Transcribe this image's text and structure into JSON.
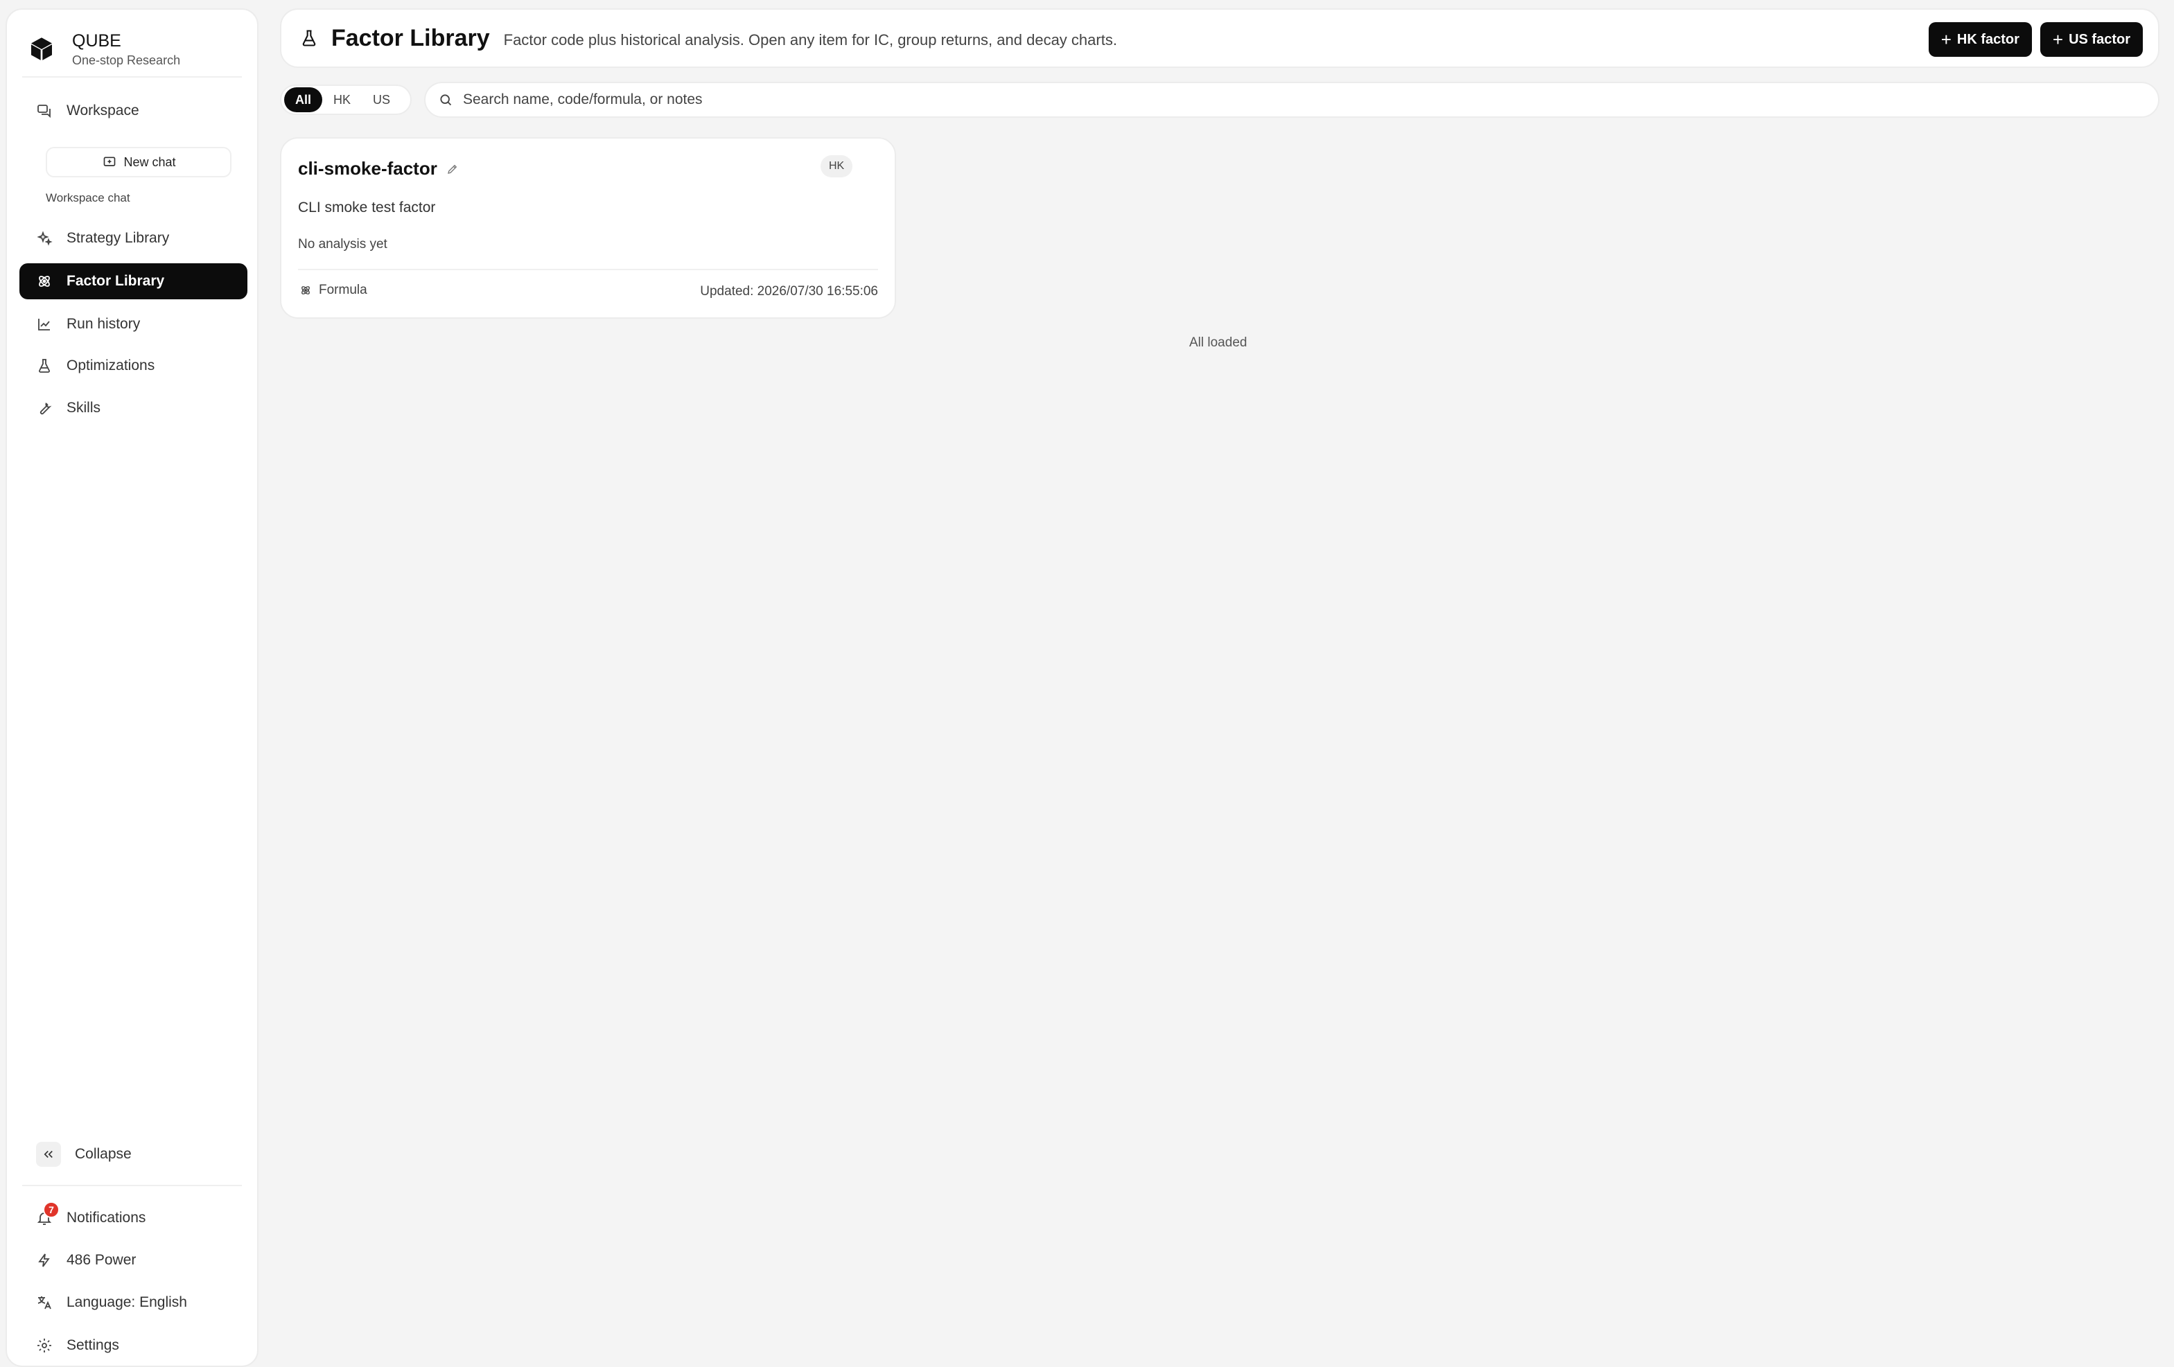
{
  "brand": {
    "name": "QUBE",
    "subtitle": "One-stop Research",
    "logo_icon": "cube-icon"
  },
  "sidebar": {
    "workspace_label": "Workspace",
    "new_chat_label": "New chat",
    "workspace_chat_label": "Workspace chat",
    "items": [
      {
        "label": "Strategy Library",
        "icon": "sparkles-icon",
        "active": false
      },
      {
        "label": "Factor Library",
        "icon": "atom-icon",
        "active": true
      },
      {
        "label": "Run history",
        "icon": "line-chart-icon",
        "active": false
      },
      {
        "label": "Optimizations",
        "icon": "flask-icon",
        "active": false
      },
      {
        "label": "Skills",
        "icon": "wrench-icon",
        "active": false
      }
    ],
    "collapse_label": "Collapse",
    "notifications_label": "Notifications",
    "notifications_count": "7",
    "power_label": "486 Power",
    "language_label": "Language: English",
    "settings_label": "Settings"
  },
  "header": {
    "title": "Factor Library",
    "description": "Factor code plus historical analysis. Open any item for IC, group returns, and decay charts.",
    "hk_button": "HK factor",
    "us_button": "US factor"
  },
  "filters": {
    "options": [
      "All",
      "HK",
      "US"
    ],
    "selected": "All"
  },
  "search": {
    "placeholder": "Search name, code/formula, or notes",
    "value": ""
  },
  "factors": [
    {
      "name": "cli-smoke-factor",
      "market": "HK",
      "description": "CLI smoke test factor",
      "status": "No analysis yet",
      "type": "Formula",
      "updated": "Updated: 2026/07/30 16:55:06"
    }
  ],
  "list_status": "All loaded",
  "colors": {
    "accent_dark": "#0c0c0c",
    "background": "#f4f4f4",
    "badge_red": "#e0342a"
  }
}
